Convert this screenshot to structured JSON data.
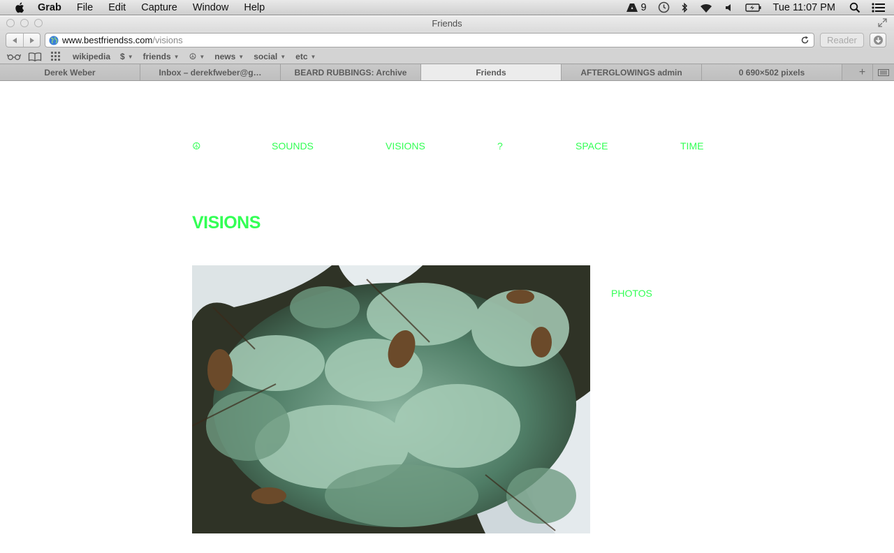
{
  "menubar": {
    "app_name": "Grab",
    "items": [
      "File",
      "Edit",
      "Capture",
      "Window",
      "Help"
    ],
    "adobe_badge_count": "9",
    "clock": "Tue 11:07 PM"
  },
  "window": {
    "title": "Friends"
  },
  "toolbar": {
    "url_host": "www.bestfriendss.com",
    "url_path": "/visions",
    "reader_label": "Reader"
  },
  "bookmarks": [
    {
      "label": "wikipedia",
      "menu": false
    },
    {
      "label": "$",
      "menu": true
    },
    {
      "label": "friends",
      "menu": true
    },
    {
      "label": "☮",
      "menu": true
    },
    {
      "label": "news",
      "menu": true
    },
    {
      "label": "social",
      "menu": true
    },
    {
      "label": "etc",
      "menu": true
    }
  ],
  "tabs": [
    {
      "label": "Derek Weber",
      "active": false
    },
    {
      "label": "Inbox – derekfweber@g…",
      "active": false
    },
    {
      "label": "BEARD RUBBINGS: Archive",
      "active": false
    },
    {
      "label": "Friends",
      "active": true
    },
    {
      "label": "AFTERGLOWINGS admin",
      "active": false
    },
    {
      "label": "0 690×502 pixels",
      "active": false
    }
  ],
  "site": {
    "nav": [
      "☮",
      "SOUNDS",
      "VISIONS",
      "?",
      "SPACE",
      "TIME"
    ],
    "page_title": "VISIONS",
    "side_link": "PHOTOS",
    "accent_color": "#33ff55"
  }
}
